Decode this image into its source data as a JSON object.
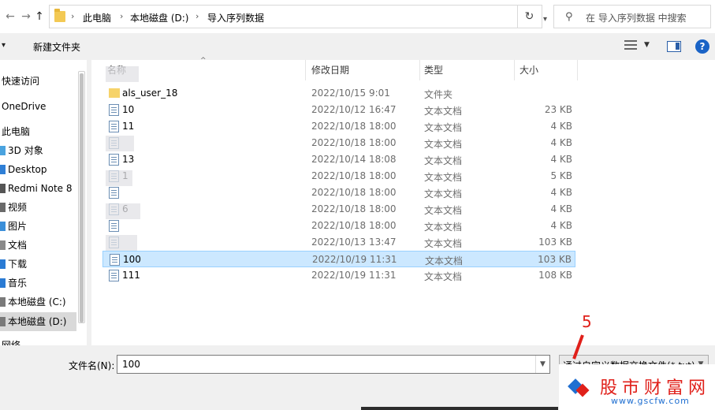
{
  "address": {
    "breadcrumbs": [
      "此电脑",
      "本地磁盘 (D:)",
      "导入序列数据"
    ]
  },
  "search": {
    "placeholder": "在 导入序列数据 中搜索"
  },
  "toolbar": {
    "new_folder_label": "新建文件夹"
  },
  "navigation": {
    "items": [
      {
        "label": "快速访问"
      },
      {
        "label": "OneDrive"
      },
      {
        "label": "此电脑"
      },
      {
        "label": "3D 对象"
      },
      {
        "label": "Desktop"
      },
      {
        "label": "Redmi Note 8"
      },
      {
        "label": "视频"
      },
      {
        "label": "图片"
      },
      {
        "label": "文档"
      },
      {
        "label": "下载"
      },
      {
        "label": "音乐"
      },
      {
        "label": "本地磁盘 (C:)"
      },
      {
        "label": "本地磁盘 (D:)",
        "selected": true
      },
      {
        "label": "网络"
      }
    ]
  },
  "columns": {
    "name": "名称",
    "date": "修改日期",
    "type": "类型",
    "size": "大小"
  },
  "files": [
    {
      "name": "als_user_18",
      "date": "2022/10/15 9:01",
      "type": "文件夹",
      "size": "",
      "kind": "folder"
    },
    {
      "name": "10",
      "date": "2022/10/12 16:47",
      "type": "文本文档",
      "size": "23 KB",
      "kind": "file"
    },
    {
      "name": "11",
      "date": "2022/10/18 18:00",
      "type": "文本文档",
      "size": "4 KB",
      "kind": "file"
    },
    {
      "name": "",
      "date": "2022/10/18 18:00",
      "type": "文本文档",
      "size": "4 KB",
      "kind": "file"
    },
    {
      "name": "13",
      "date": "2022/10/14 18:08",
      "type": "文本文档",
      "size": "4 KB",
      "kind": "file"
    },
    {
      "name": "1",
      "date": "2022/10/18 18:00",
      "type": "文本文档",
      "size": "5 KB",
      "kind": "file"
    },
    {
      "name": "",
      "date": "2022/10/18 18:00",
      "type": "文本文档",
      "size": "4 KB",
      "kind": "file"
    },
    {
      "name": "6",
      "date": "2022/10/18 18:00",
      "type": "文本文档",
      "size": "4 KB",
      "kind": "file"
    },
    {
      "name": "",
      "date": "2022/10/18 18:00",
      "type": "文本文档",
      "size": "4 KB",
      "kind": "file"
    },
    {
      "name": "",
      "date": "2022/10/13 13:47",
      "type": "文本文档",
      "size": "103 KB",
      "kind": "file"
    },
    {
      "name": "100",
      "date": "2022/10/19 11:31",
      "type": "文本文档",
      "size": "103 KB",
      "kind": "file",
      "selected": true
    },
    {
      "name": "111",
      "date": "2022/10/19 11:31",
      "type": "文本文档",
      "size": "108 KB",
      "kind": "file"
    }
  ],
  "bottom": {
    "filename_label": "文件名(N):",
    "filename_value": "100",
    "filetype_value": "通过自定义数据交换文件(*.txt)"
  },
  "annotation": {
    "number": "5"
  },
  "watermark": {
    "title": "股市财富网",
    "url": "www.gscfw.com"
  },
  "colors": {
    "selection": "#cce8ff",
    "selection_border": "#99d1ff",
    "annotation": "#e0201a",
    "help": "#1a63c6"
  }
}
